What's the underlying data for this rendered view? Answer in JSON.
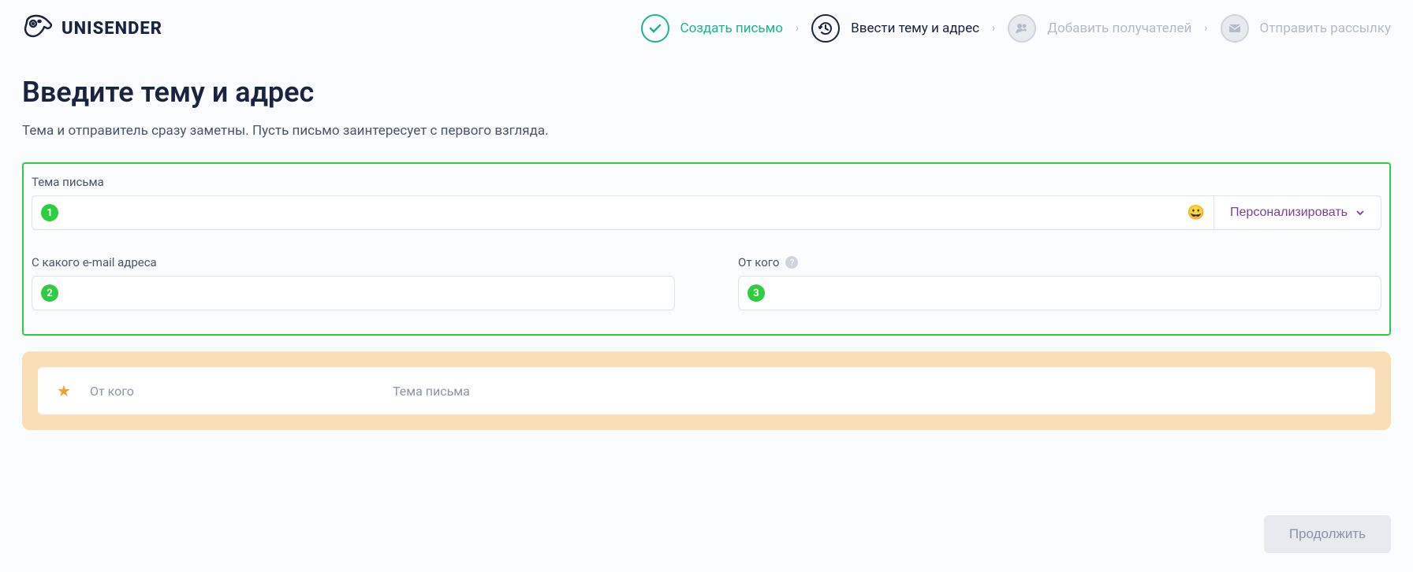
{
  "header": {
    "logo_text": "UNISENDER"
  },
  "stepper": {
    "step1": {
      "label": "Создать письмо"
    },
    "step2": {
      "label": "Ввести тему и адрес"
    },
    "step3": {
      "label": "Добавить получателей"
    },
    "step4": {
      "label": "Отправить рассылку"
    }
  },
  "page": {
    "title": "Введите тему и адрес",
    "subtitle": "Тема и отправитель сразу заметны. Пусть письмо заинтересует с первого взгляда."
  },
  "form": {
    "subject_label": "Тема письма",
    "subject_value": "",
    "subject_badge": "1",
    "emoji": "😀",
    "personalize_label": "Персонализировать",
    "from_email_label": "С какого e-mail адреса",
    "from_email_value": "",
    "from_email_badge": "2",
    "from_name_label": "От кого",
    "from_name_value": "",
    "from_name_badge": "3",
    "help_tooltip": "?"
  },
  "preview": {
    "from_placeholder": "От кого",
    "subject_placeholder": "Тема письма"
  },
  "actions": {
    "continue_label": "Продолжить"
  }
}
